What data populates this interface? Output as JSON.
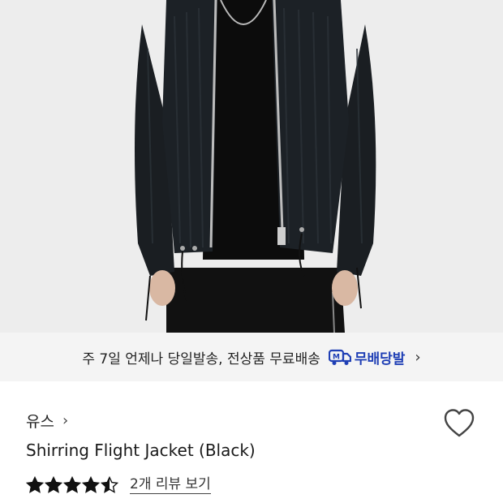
{
  "hero": {
    "image_name": "product-photo-model-wearing-black-jacket"
  },
  "delivery": {
    "message": "주 7일 언제나 당일발송, 전상품 무료배송",
    "badge_icon": "m-delivery-truck-icon",
    "badge_label": "무배당발",
    "badge_color": "#1f3fb5"
  },
  "product": {
    "brand": "유스",
    "title": "Shirring Flight Jacket (Black)",
    "rating": 4.5,
    "rating_max": 5,
    "review_link": "2개 리뷰 보기"
  }
}
